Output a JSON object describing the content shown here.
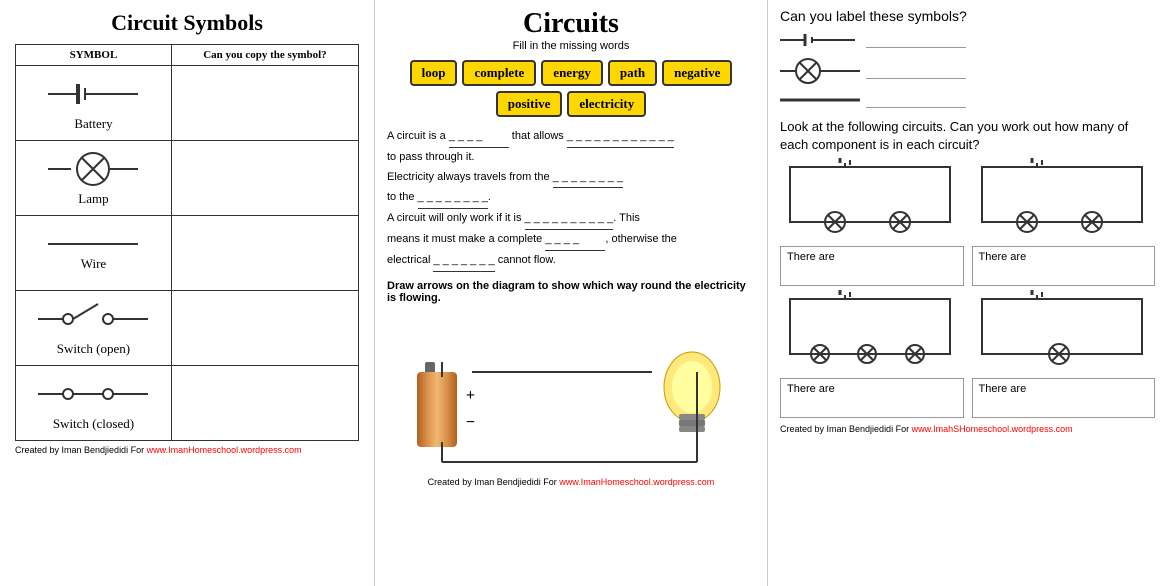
{
  "left": {
    "title": "Circuit Symbols",
    "table_headers": [
      "SYMBOL",
      "Can you copy the symbol?"
    ],
    "rows": [
      {
        "symbol": "Battery",
        "type": "battery"
      },
      {
        "symbol": "Lamp",
        "type": "lamp"
      },
      {
        "symbol": "Wire",
        "type": "wire"
      },
      {
        "symbol": "Switch (open)",
        "type": "switch_open"
      },
      {
        "symbol": "Switch (closed)",
        "type": "switch_closed"
      }
    ]
  },
  "middle": {
    "title": "Circuits",
    "instruction": "Fill in the missing words",
    "words": [
      "loop",
      "complete",
      "energy",
      "path",
      "negative",
      "positive",
      "electricity"
    ],
    "sentences": [
      "A circuit is a _ _ _ _ that allows _ _ _ _ _ _ _ _ _ _ _ _",
      "to pass through it.",
      "Electricity always travels from the _ _ _ _ _ _ _ _",
      "to the _ _ _ _ _ _ _ _.",
      "A circuit will only work if it is _ _ _ _ _ _ _ _ _ _. This",
      "means it must make a complete _ _ _ _, otherwise the",
      "electrical _ _ _ _ _ _ _ cannot flow."
    ],
    "draw_instruction": "Draw arrows on the diagram to show which way round the electricity is flowing.",
    "footer": "Created by Iman Bendjiedidi For",
    "footer_url": "www.ImanHomeschool.wordpress.com"
  },
  "right": {
    "label_title": "Can you label these symbols?",
    "circuits_title": "Look at the following circuits. Can you work out how many of each component is in each circuit?",
    "there_are_labels": [
      "There are",
      "There are",
      "There are",
      "There are"
    ],
    "footer": "Created by Iman Bendjiedidi For",
    "footer_url": "www.ImahSHomeschool.wordpress.com"
  }
}
